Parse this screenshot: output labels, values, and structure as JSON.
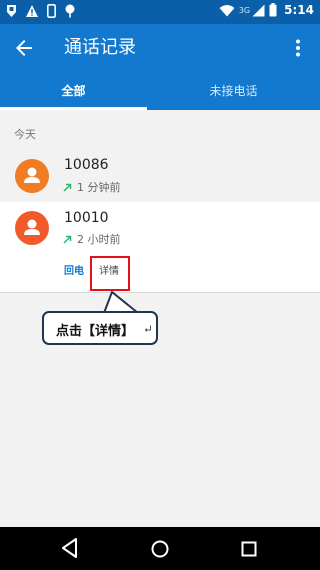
{
  "status_bar": {
    "network": "3G",
    "time": "5:14",
    "icons": [
      "shield-icon",
      "warning-icon",
      "phone-outline-icon",
      "tree-icon",
      "wifi-icon",
      "signal-icon",
      "battery-icon"
    ]
  },
  "app_bar": {
    "title": "通话记录",
    "back_icon": "arrow-back-icon",
    "more_icon": "more-vert-icon"
  },
  "tabs": [
    {
      "label": "全部",
      "selected": true
    },
    {
      "label": "未接电话",
      "selected": false
    }
  ],
  "section_header": "今天",
  "calls": [
    {
      "number": "10086",
      "time_ago": "1 分钟前",
      "direction": "outgoing",
      "avatar_color": "#f07c23"
    },
    {
      "number": "10010",
      "time_ago": "2 小时前",
      "direction": "outgoing",
      "avatar_color": "#f25a2c"
    }
  ],
  "expanded_actions": {
    "callback_label": "回电",
    "details_label": "详情"
  },
  "callout": {
    "text": "点击【详情】"
  },
  "colors": {
    "primary": "#1279cf",
    "status_bar": "#0a5fa8",
    "highlight": "#e1121a"
  }
}
